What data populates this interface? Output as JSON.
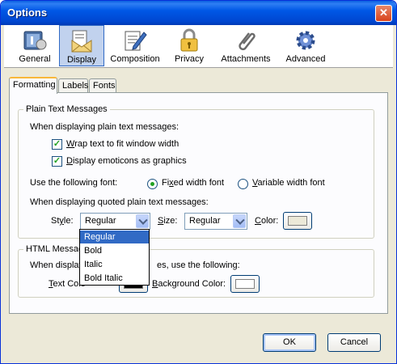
{
  "window": {
    "title": "Options",
    "close_symbol": "✕"
  },
  "toolbar": {
    "items": [
      {
        "label": "General",
        "icon": "general-icon"
      },
      {
        "label": "Display",
        "icon": "display-icon",
        "selected": true
      },
      {
        "label": "Composition",
        "icon": "composition-icon"
      },
      {
        "label": "Privacy",
        "icon": "lock-icon"
      },
      {
        "label": "Attachments",
        "icon": "paperclip-icon"
      },
      {
        "label": "Advanced",
        "icon": "gear-icon"
      }
    ]
  },
  "tabs": [
    {
      "label": "Formatting",
      "active": true
    },
    {
      "label": "Labels"
    },
    {
      "label": "Fonts"
    }
  ],
  "plain_text": {
    "group_title": "Plain Text Messages",
    "intro": "When displaying plain text messages:",
    "wrap_label_u": "W",
    "wrap_label_rest": "rap text to fit window width",
    "wrap_checked": true,
    "emoticons_label_u": "D",
    "emoticons_label_rest": "isplay emoticons as graphics",
    "emoticons_checked": true,
    "font_label": "Use the following font:",
    "fixed_label_pre": "Fi",
    "fixed_label_u": "x",
    "fixed_label_rest": "ed width font",
    "fixed_selected": true,
    "variable_label_u": "V",
    "variable_label_rest": "ariable width font",
    "quoted_intro": "When displaying quoted plain text messages:",
    "style_label_pre": "St",
    "style_label_u": "y",
    "style_label_rest": "le:",
    "style_value": "Regular",
    "size_label_u": "S",
    "size_label_rest": "ize:",
    "size_value": "Regular",
    "color_label_pre": "",
    "color_label_u": "C",
    "color_label_rest": "olor:",
    "color_swatch": "#ece9d8"
  },
  "style_dropdown": {
    "options": [
      "Regular",
      "Bold",
      "Italic",
      "Bold Italic"
    ],
    "selected_index": 0
  },
  "html_messages": {
    "group_title_visible": "HTML Messag",
    "intro_left": "When display",
    "intro_right": "es, use the following:",
    "text_color_label_u": "T",
    "text_color_label_rest": "ext Colo",
    "text_color_swatch": "#000000",
    "bg_color_label_u": "B",
    "bg_color_label_rest": "ackground Color:",
    "bg_color_swatch": "#ffffff"
  },
  "buttons": {
    "ok": "OK",
    "cancel": "Cancel"
  }
}
